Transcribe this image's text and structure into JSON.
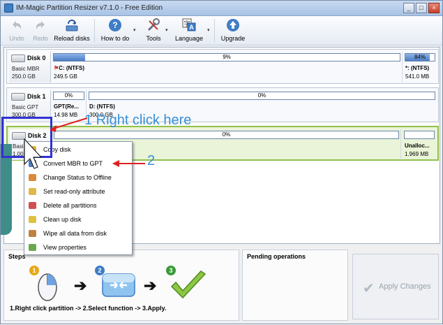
{
  "window": {
    "title": "IM-Magic Partition Resizer v7.1.0 - Free Edition",
    "min_glyph": "_",
    "max_glyph": "□",
    "close_glyph": "×"
  },
  "toolbar": {
    "undo": "Undo",
    "redo": "Redo",
    "reload": "Reload disks",
    "howto": "How to do",
    "tools": "Tools",
    "language": "Language",
    "upgrade": "Upgrade"
  },
  "disks": [
    {
      "name": "Disk 0",
      "type": "Basic MBR",
      "size": "250.0 GB",
      "partitions": [
        {
          "bar_text": "9%",
          "used_fraction": 0.09,
          "label": "C: (NTFS)",
          "size": "249.5 GB"
        },
        {
          "bar_text": "84%",
          "used_fraction": 0.84,
          "label": "*: (NTFS)",
          "size": "541.0 MB"
        }
      ]
    },
    {
      "name": "Disk 1",
      "type": "Basic GPT",
      "size": "300.0 GB",
      "partitions": [
        {
          "bar_text": "0%",
          "used_fraction": 0.0,
          "label": "GPT(Re...",
          "size": "14.98 MB"
        },
        {
          "bar_text": "0%",
          "used_fraction": 0.0,
          "label": "D: (NTFS)",
          "size": "300.0 GB"
        }
      ]
    },
    {
      "name": "Disk 2",
      "type": "Basic",
      "size": "1.00",
      "partitions": [
        {
          "bar_text": "0%",
          "used_fraction": 0.0,
          "label": "",
          "size": ""
        },
        {
          "bar_text": "",
          "used_fraction": 0.0,
          "label": "Unalloc...",
          "size": "1.969 MB"
        }
      ]
    }
  ],
  "context_menu": [
    {
      "label": "Copy disk",
      "icon": "copy-icon",
      "color": "#d9b23a"
    },
    {
      "label": "Convert MBR to GPT",
      "icon": "convert-icon",
      "color": "#4a7cc4"
    },
    {
      "label": "Change Status to Offline",
      "icon": "status-icon",
      "color": "#d98a3a"
    },
    {
      "label": "Set read-only attribute",
      "icon": "lock-icon",
      "color": "#e0b84a"
    },
    {
      "label": "Delete all partitions",
      "icon": "delete-icon",
      "color": "#d05050"
    },
    {
      "label": "Clean up disk",
      "icon": "clean-icon",
      "color": "#e0c040"
    },
    {
      "label": "Wipe all data from disk",
      "icon": "wipe-icon",
      "color": "#c08040"
    },
    {
      "label": "View properties",
      "icon": "properties-icon",
      "color": "#6aa84f"
    }
  ],
  "annotations": {
    "step1": "1 Right click here",
    "step2": "2"
  },
  "steps": {
    "title": "Steps",
    "num1": "1",
    "num2": "2",
    "num3": "3",
    "caption": "1.Right click partition -> 2.Select function -> 3.Apply."
  },
  "pending": {
    "title": "Pending operations"
  },
  "apply": {
    "label": "Apply Changes"
  },
  "colors": {
    "accent": "#3a8fd6",
    "selected_disk_border": "#8fc049",
    "selection_box": "#3232d2",
    "arrow_red": "#e02020"
  }
}
